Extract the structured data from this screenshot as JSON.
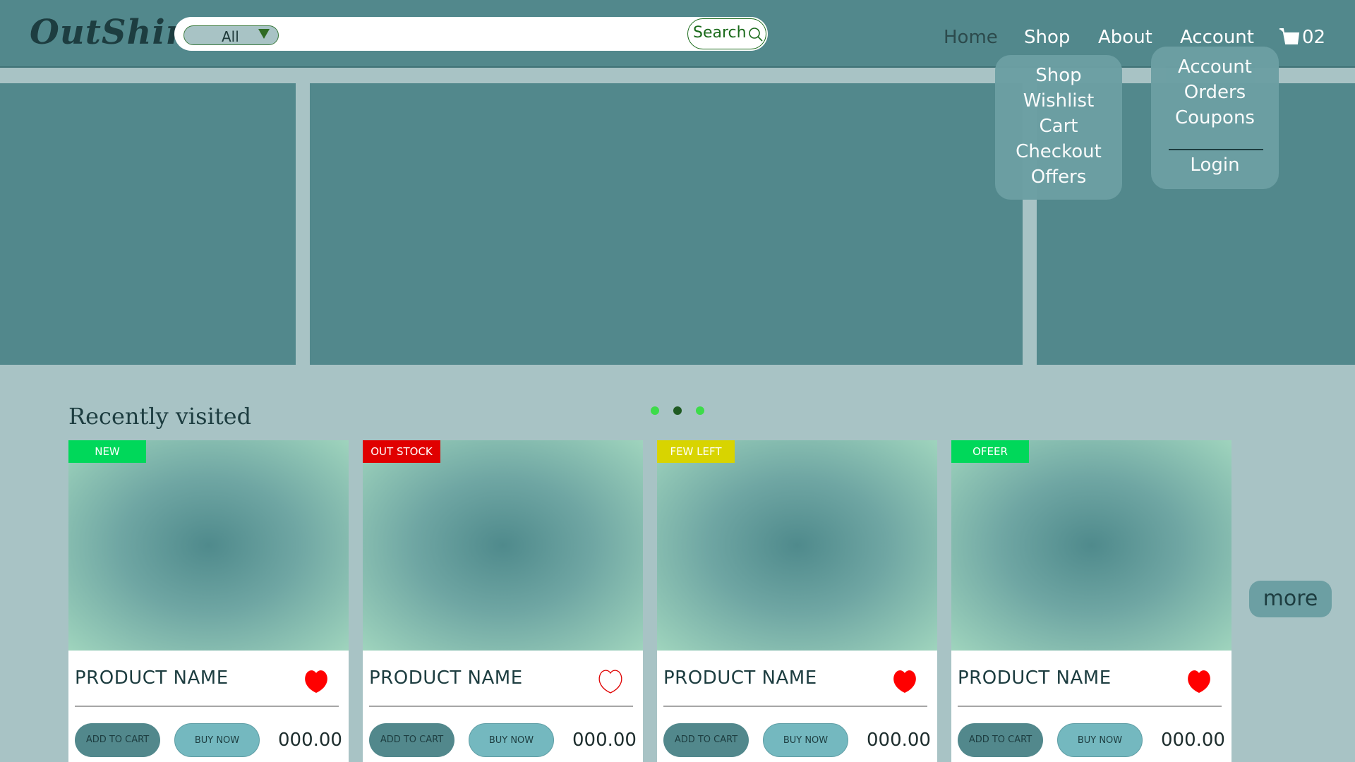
{
  "header": {
    "logo": "OutShine",
    "search": {
      "category": "All",
      "button_label": "Search"
    },
    "nav": {
      "home": "Home",
      "shop": "Shop",
      "about": "About",
      "account": "Account"
    },
    "cart_count": "02"
  },
  "shop_menu": {
    "items": [
      "Shop",
      "Wishlist",
      "Cart",
      "Checkout",
      "Offers"
    ]
  },
  "account_menu": {
    "items": [
      "Account",
      "Orders",
      "Coupons"
    ],
    "login": "Login"
  },
  "recent": {
    "title": "Recently visited",
    "carousel": {
      "pages": 3,
      "active_page": 2
    },
    "products": [
      {
        "badge": "NEW",
        "name": "PRODUCT NAME",
        "wishlisted": true,
        "add_to_cart": "ADD TO CART",
        "buy_now": "BUY NOW",
        "price": "000.00"
      },
      {
        "badge": "OUT STOCK",
        "name": "PRODUCT NAME",
        "wishlisted": false,
        "add_to_cart": "ADD TO CART",
        "buy_now": "BUY NOW",
        "price": "000.00"
      },
      {
        "badge": "FEW LEFT",
        "name": "PRODUCT NAME",
        "wishlisted": true,
        "add_to_cart": "ADD TO CART",
        "buy_now": "BUY NOW",
        "price": "000.00"
      },
      {
        "badge": "OFEER",
        "name": "PRODUCT NAME",
        "wishlisted": true,
        "add_to_cart": "ADD TO CART",
        "buy_now": "BUY NOW",
        "price": "000.00"
      }
    ],
    "more": "more"
  },
  "colors": {
    "header": "#52888c",
    "page": "#a8c3c5",
    "badge_new": "#00d85a",
    "badge_out": "#e00000",
    "badge_few": "#d8d400",
    "wishlist": "#ff0000"
  },
  "icons": {
    "search": "search-icon",
    "cart": "cart-icon",
    "dropdown": "chevron-down-icon",
    "wishlist": "heart-icon"
  }
}
